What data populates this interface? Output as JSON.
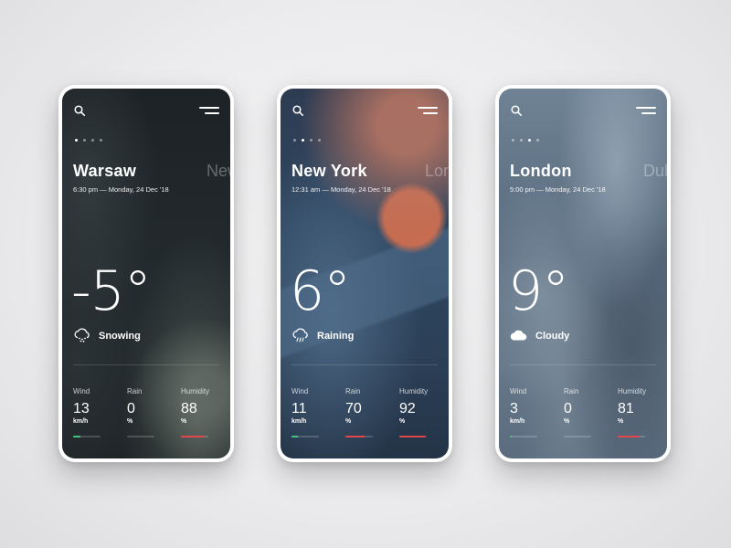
{
  "colors": {
    "wind_bar": "#3ec77a",
    "rain_bar": "#e0474c",
    "humidity_bar": "#e0474c"
  },
  "icons": {
    "search": "search-icon",
    "menu": "menu-icon",
    "snow": "snow-cloud-icon",
    "rain": "rain-cloud-icon",
    "cloud": "cloud-icon"
  },
  "cards": [
    {
      "city": "Warsaw",
      "next_city": "New",
      "datetime": "6:30 pm — Monday, 24 Dec '18",
      "temperature": "-5°",
      "condition": "Snowing",
      "active_dot": 0,
      "stats": [
        {
          "label": "Wind",
          "value": "13",
          "unit": "km/h",
          "level": 0.25
        },
        {
          "label": "Rain",
          "value": "0",
          "unit": "%",
          "level": 0.0
        },
        {
          "label": "Humidity",
          "value": "88",
          "unit": "%",
          "level": 0.88
        }
      ]
    },
    {
      "city": "New York",
      "next_city": "Lon",
      "datetime": "12:31 am — Monday, 24 Dec '18",
      "temperature": "6°",
      "condition": "Raining",
      "active_dot": 1,
      "stats": [
        {
          "label": "Wind",
          "value": "11",
          "unit": "km/h",
          "level": 0.22
        },
        {
          "label": "Rain",
          "value": "70",
          "unit": "%",
          "level": 0.7
        },
        {
          "label": "Humidity",
          "value": "92",
          "unit": "%",
          "level": 0.92
        }
      ]
    },
    {
      "city": "London",
      "next_city": "Dul",
      "datetime": "5:00 pm — Monday, 24 Dec '18",
      "temperature": "9°",
      "condition": "Cloudy",
      "active_dot": 2,
      "stats": [
        {
          "label": "Wind",
          "value": "3",
          "unit": "km/h",
          "level": 0.06
        },
        {
          "label": "Rain",
          "value": "0",
          "unit": "%",
          "level": 0.0
        },
        {
          "label": "Humidity",
          "value": "81",
          "unit": "%",
          "level": 0.81
        }
      ]
    }
  ]
}
